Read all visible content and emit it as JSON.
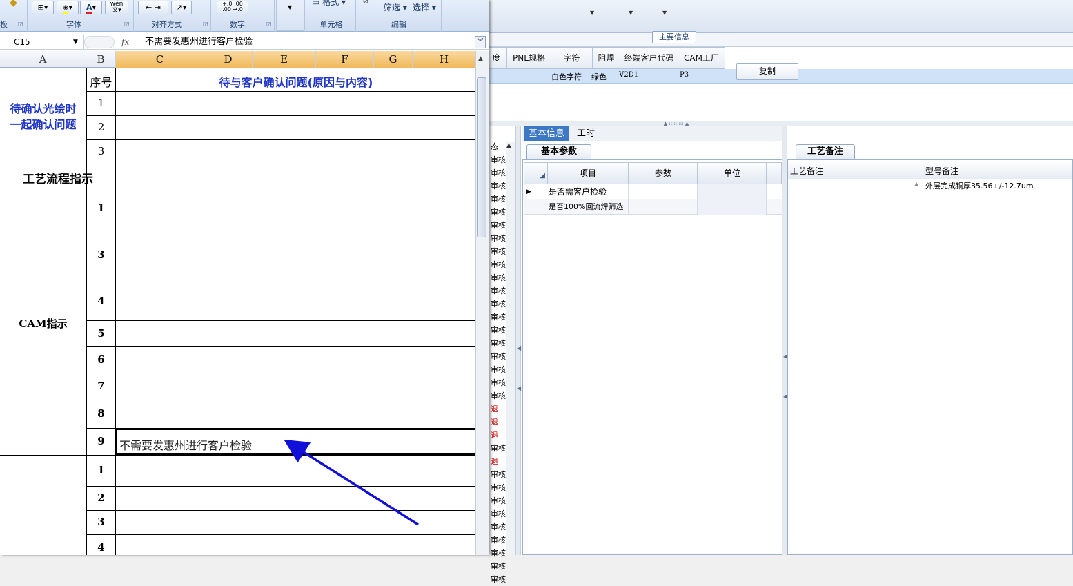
{
  "excel": {
    "ribbon": {
      "groups": [
        {
          "label": "板"
        },
        {
          "label": "字体"
        },
        {
          "label": "对齐方式"
        },
        {
          "label": "数字"
        },
        {
          "label": "单元格"
        },
        {
          "label": "编辑"
        }
      ],
      "cell_style_label": "格式",
      "filter_label": "筛选",
      "select_label": "选择",
      "number_format_increase": ".00→.0",
      "number_format_decrease": ".0→.00"
    },
    "name_box": "C15",
    "fx_label": "fx",
    "formula": "不需要发惠州进行客户检验",
    "columns": [
      "A",
      "B",
      "C",
      "D",
      "E",
      "F",
      "G",
      "H"
    ],
    "header": {
      "seq": "序号",
      "title": "待与客户确认问题(原因与内容)"
    },
    "section_pending": {
      "label_line1": "待确认光绘时",
      "label_line2": "一起确认问题",
      "rows": [
        "1",
        "2",
        "3"
      ]
    },
    "section_process": {
      "label": "工艺流程指示"
    },
    "section_cam": {
      "label": "CAM指示",
      "rows": [
        "1",
        "3",
        "4",
        "5",
        "6",
        "7",
        "8",
        "9"
      ],
      "active_cell_text": "不需要发惠州进行客户检验"
    },
    "section_bottom": {
      "rows": [
        "1",
        "2",
        "3",
        "4"
      ]
    }
  },
  "erp": {
    "main_info_tab": "主要信息",
    "column_headers": [
      "度",
      "PNL规格",
      "字符",
      "阻焊",
      "终端客户代码",
      "CAM工厂"
    ],
    "data_row": {
      "char": "白色字符",
      "solder": "绿色",
      "customer": "V2D1",
      "cam": "P3"
    },
    "copy_button": "复制",
    "status_header": "态",
    "status_items": [
      "审核",
      "审核",
      "审核",
      "审核",
      "审核",
      "审核",
      "审核",
      "审核",
      "审核",
      "审核",
      "审核",
      "审核",
      "审核",
      "审核",
      "审核",
      "审核",
      "审核",
      "审核",
      "审核",
      "退",
      "退",
      "退",
      "审核",
      "退",
      "审核",
      "审核",
      "审核",
      "审核",
      "审核",
      "审核",
      "审核",
      "审核",
      "审核"
    ],
    "tabs": [
      "基本信息",
      "工时"
    ],
    "basic_params": {
      "subtab": "基本参数",
      "headers": [
        "项目",
        "参数",
        "单位"
      ],
      "rows": [
        {
          "item": "是否需客户检验",
          "param": "",
          "unit": ""
        },
        {
          "item": "是否100%回流焊筛选",
          "param": "",
          "unit": ""
        }
      ]
    },
    "process_notes": {
      "subtab": "工艺备注",
      "headers": [
        "工艺备注",
        "型号备注"
      ],
      "model_note": "外层完成铜厚35.56+/-12.7um"
    },
    "accent_color": "#3c78c3",
    "status_red": "#d01010"
  },
  "annotation": {
    "arrow_color": "#1010d8"
  }
}
